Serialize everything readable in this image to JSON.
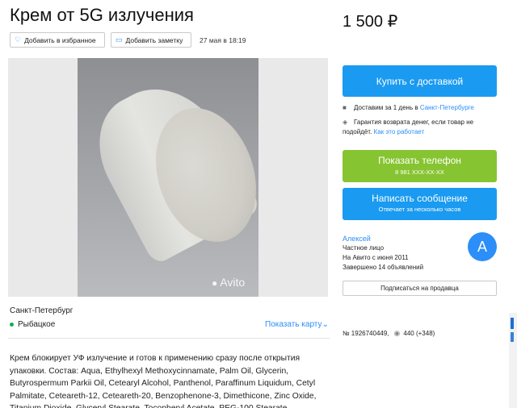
{
  "listing": {
    "title": "Крем от 5G излучения",
    "price": "1 500 ₽",
    "add_favorite": "Добавить в избранное",
    "add_note": "Добавить заметку",
    "date": "27 мая в 18:19",
    "watermark": "Avito",
    "city": "Санкт-Петербург",
    "district": "Рыбацкое",
    "show_map": "Показать карту",
    "description": "Крем блокирует УФ излучение и готов к применению сразу после открытия упаковки. Состав: Aqua, Ethylhexyl Methoxycinnamate, Palm Oil, Glycerin, Butyrospermum Parkii Oil, Cetearyl Alcohol, Panthenol, Paraffinum Liquidum, Cetyl Palmitate, Ceteareth-12, Ceteareth-20, Benzophenone-3, Dimethicone, Zinc Oxide, Titanium Dioxide, Glyceryl Stearate, Tocopheryl Acetate, PEG-100 Stearate"
  },
  "sidebar": {
    "buy_label": "Купить с доставкой",
    "delivery_text": "Доставим за 1 день в",
    "delivery_city": "Санкт-Петербурге",
    "guarantee_text": "Гарантия возврата денег, если товар не подойдёт.",
    "guarantee_link": "Как это работает",
    "phone_label": "Показать телефон",
    "phone_number": "8 981 XXX-XX-XX",
    "message_label": "Написать сообщение",
    "message_sub": "Отвечает за несколько часов",
    "seller_name": "Алексей",
    "seller_type": "Частное лицо",
    "seller_since": "На Авито с июня 2011",
    "seller_completed": "Завершено 14 объявлений",
    "avatar_letter": "A",
    "subscribe_label": "Подписаться на продавца",
    "listing_number": "№ 1926740449,",
    "views": "440 (+348)"
  },
  "colors": {
    "accent_blue": "#1a9af0",
    "phone_green": "#87c431",
    "link_blue": "#2c8ef8"
  },
  "icons": [
    "heart-icon",
    "note-icon",
    "chevron-down-icon",
    "truck-icon",
    "shield-icon",
    "eye-icon"
  ]
}
